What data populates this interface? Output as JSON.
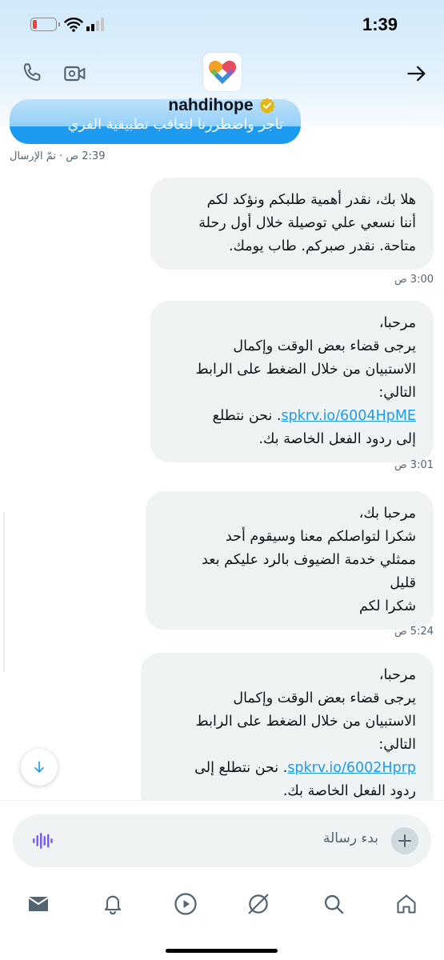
{
  "status_bar": {
    "time": "1:39"
  },
  "header": {
    "username": "nahdihope",
    "verified": true,
    "icons": [
      "phone-icon",
      "video-icon",
      "back-arrow-icon",
      "verified-badge-icon"
    ]
  },
  "messages": [
    {
      "direction": "outgoing",
      "lines": [
        "تاجر واضطررنا لتعاقب تطبيقية الفري"
      ],
      "meta": "2:39 ص · تمّ الإرسال"
    },
    {
      "direction": "incoming",
      "lines": [
        "هلا بك، نقدر أهمية طلبكم ونؤكد لكم",
        "أننا نسعي علي توصيلة خلال أول رحلة",
        "متاحة. نقدر صبركم. طاب يومك."
      ],
      "meta": "3:00 ص"
    },
    {
      "direction": "incoming",
      "lines": [
        "مرحبا،",
        "يرجى قضاء بعض الوقت وإكمال",
        "الاستبيان من خلال الضغط على الرابط",
        "التالي:"
      ],
      "link": "spkrv.io/6004HpME",
      "link_suffix": ". نحن نتطلع",
      "tail": "إلى ردود الفعل الخاصة بك.",
      "meta": "3:01 ص"
    },
    {
      "direction": "incoming",
      "lines": [
        "مرحبا بك،",
        "شكرا لتواصلكم معنا وسيقوم أحد",
        "ممثلي خدمة الضيوف بالرد عليكم بعد",
        "قليل",
        "شكرا لكم"
      ],
      "meta": "5:24 ص"
    },
    {
      "direction": "incoming",
      "lines": [
        "مرحبا،",
        "يرجى قضاء بعض الوقت وإكمال",
        "الاستبيان من خلال الضغط على الرابط",
        "التالي:"
      ],
      "link": "spkrv.io/6002Hprp",
      "link_suffix": ". نحن نتطلع إلى",
      "tail": "ردود الفعل الخاصة بك."
    }
  ],
  "composer": {
    "placeholder": "بدء رسالة"
  },
  "tab_bar": {
    "icons": [
      "mail-icon",
      "bell-icon",
      "play-icon",
      "grok-icon",
      "search-icon",
      "home-icon"
    ],
    "active": "mail-icon"
  },
  "colors": {
    "accent": "#1d9bf0",
    "bubble_incoming": "#eff3f4",
    "header_tint": "#cee8fa",
    "voice_icon": "#7856ff",
    "battery_low": "#ff3b30"
  }
}
